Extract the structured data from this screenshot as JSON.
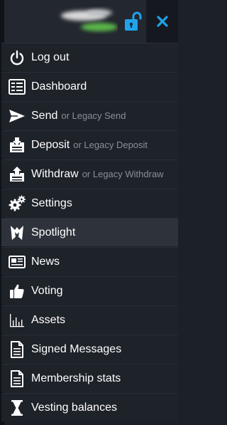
{
  "header": {
    "lock_icon": "unlock-icon",
    "close_icon": "close-icon",
    "accent": "#1fa3ea"
  },
  "menu": [
    {
      "icon": "power-icon",
      "label": "Log out",
      "sub": ""
    },
    {
      "icon": "dashboard-icon",
      "label": "Dashboard",
      "sub": ""
    },
    {
      "icon": "send-icon",
      "label": "Send",
      "sub": "or Legacy Send"
    },
    {
      "icon": "deposit-icon",
      "label": "Deposit",
      "sub": "or Legacy Deposit"
    },
    {
      "icon": "withdraw-icon",
      "label": "Withdraw",
      "sub": "or Legacy Withdraw"
    },
    {
      "icon": "gears-icon",
      "label": "Settings",
      "sub": ""
    },
    {
      "icon": "spotlight-icon",
      "label": "Spotlight",
      "sub": "",
      "active": true
    },
    {
      "icon": "news-icon",
      "label": "News",
      "sub": ""
    },
    {
      "icon": "thumbs-up-icon",
      "label": "Voting",
      "sub": ""
    },
    {
      "icon": "bar-chart-icon",
      "label": "Assets",
      "sub": ""
    },
    {
      "icon": "document-icon",
      "label": "Signed Messages",
      "sub": ""
    },
    {
      "icon": "document-icon",
      "label": "Membership stats",
      "sub": ""
    },
    {
      "icon": "hourglass-icon",
      "label": "Vesting balances",
      "sub": ""
    }
  ]
}
